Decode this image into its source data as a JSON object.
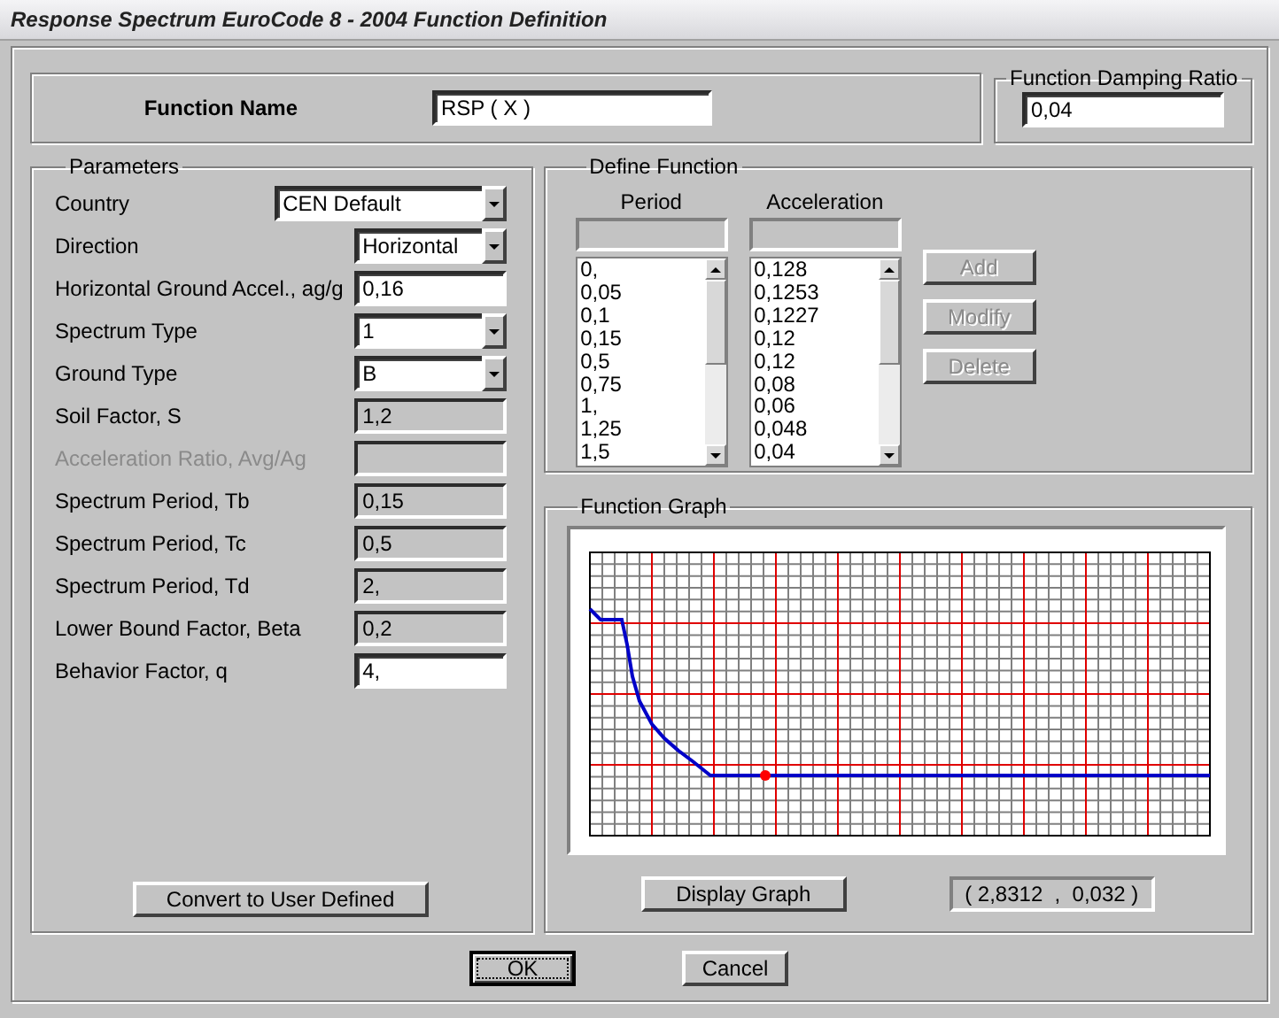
{
  "window": {
    "title": "Response Spectrum EuroCode 8 - 2004 Function Definition"
  },
  "function_name": {
    "label": "Function Name",
    "value": "RSP ( X )"
  },
  "damping": {
    "title": "Function Damping Ratio",
    "value": "0,04"
  },
  "parameters": {
    "title": "Parameters",
    "rows": [
      {
        "label": "Country",
        "kind": "wide-combo",
        "value": "CEN Default",
        "disabled": false
      },
      {
        "label": "Direction",
        "kind": "combo",
        "value": "Horizontal",
        "disabled": false
      },
      {
        "label": "Horizontal Ground Accel.,  ag/g",
        "kind": "input",
        "value": "0,16",
        "disabled": false
      },
      {
        "label": "Spectrum Type",
        "kind": "combo",
        "value": "1",
        "disabled": false
      },
      {
        "label": "Ground Type",
        "kind": "combo",
        "value": "B",
        "disabled": false
      },
      {
        "label": "Soil Factor, S",
        "kind": "readonly",
        "value": "1,2",
        "disabled": false
      },
      {
        "label": "Acceleration Ratio,  Avg/Ag",
        "kind": "readonly",
        "disabled": true
      },
      {
        "label": "Spectrum Period, Tb",
        "kind": "readonly",
        "value": "0,15",
        "disabled": false
      },
      {
        "label": "Spectrum Period, Tc",
        "kind": "readonly",
        "value": "0,5",
        "disabled": false
      },
      {
        "label": "Spectrum Period, Td",
        "kind": "readonly",
        "value": "2,",
        "disabled": false
      },
      {
        "label": "Lower Bound Factor, Beta",
        "kind": "readonly",
        "value": "0,2",
        "disabled": false
      },
      {
        "label": "Behavior Factor, q",
        "kind": "input",
        "value": "4,",
        "disabled": false
      }
    ],
    "convert_button": "Convert to User Defined"
  },
  "define_function": {
    "title": "Define Function",
    "columns": [
      {
        "heading": "Period",
        "values": [
          "0,",
          "0,05",
          "0,1",
          "0,15",
          "0,5",
          "0,75",
          "1,",
          "1,25",
          "1,5"
        ]
      },
      {
        "heading": "Acceleration",
        "values": [
          "0,128",
          "0,1253",
          "0,1227",
          "0,12",
          "0,12",
          "0,08",
          "0,06",
          "0,048",
          "0,04"
        ]
      }
    ],
    "buttons": [
      {
        "label": "Add",
        "disabled": true
      },
      {
        "label": "Modify",
        "disabled": true
      },
      {
        "label": "Delete",
        "disabled": true
      }
    ]
  },
  "function_graph": {
    "title": "Function Graph",
    "button": "Display Graph",
    "readout": "( 2,8312  ,  0,032 )"
  },
  "buttons": [
    {
      "label": "OK",
      "focused": true
    },
    {
      "label": "Cancel",
      "focused": false
    }
  ]
}
